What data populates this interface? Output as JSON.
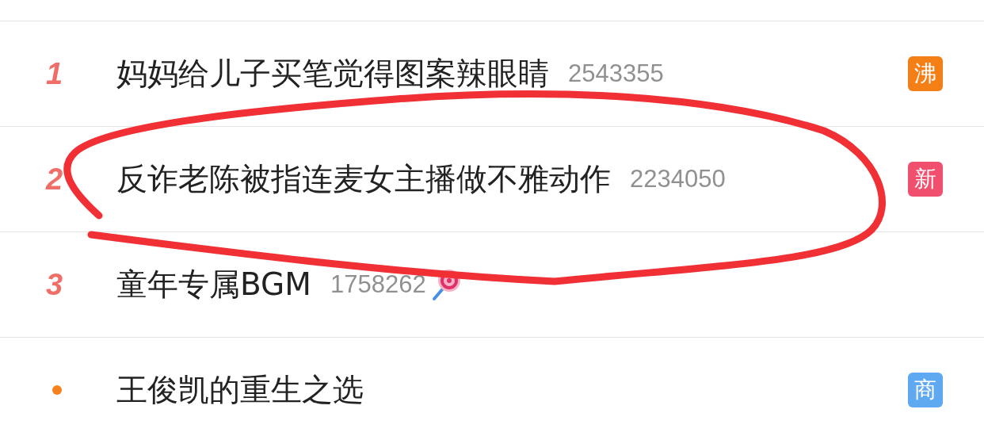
{
  "hot_search_list": [
    {
      "rank": {
        "kind": "number",
        "text": "1"
      },
      "title": "妈妈给儿子买笔觉得图案辣眼睛",
      "count": "2543355",
      "badge": {
        "text": "沸",
        "color": "#f57f17"
      }
    },
    {
      "rank": {
        "kind": "number",
        "text": "2"
      },
      "title": "反诈老陈被指连麦女主播做不雅动作",
      "count": "2234050",
      "badge": {
        "text": "新",
        "color": "#f0506e"
      }
    },
    {
      "rank": {
        "kind": "number",
        "text": "3"
      },
      "title": "童年专属BGM",
      "count": "1758262",
      "has_emoji": true
    },
    {
      "rank": {
        "kind": "dot",
        "color": "#f5821f"
      },
      "title": "王俊凯的重生之选",
      "badge": {
        "text": "商",
        "color": "#5fa8f2"
      }
    }
  ]
}
